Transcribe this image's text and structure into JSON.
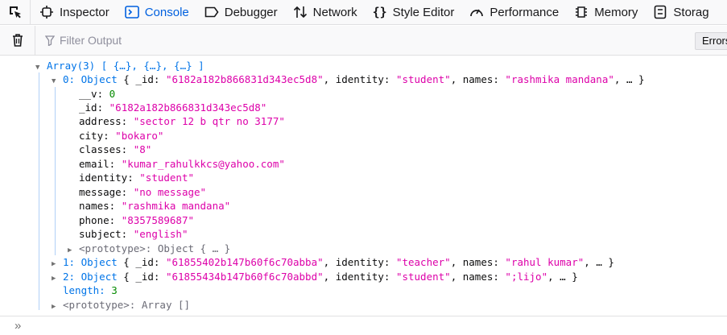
{
  "tabs": [
    {
      "label": "Inspector",
      "icon": "inspector-icon"
    },
    {
      "label": "Console",
      "icon": "console-icon",
      "selected": true
    },
    {
      "label": "Debugger",
      "icon": "debugger-icon"
    },
    {
      "label": "Network",
      "icon": "network-icon"
    },
    {
      "label": "Style Editor",
      "icon": "style-editor-icon"
    },
    {
      "label": "Performance",
      "icon": "performance-icon"
    },
    {
      "label": "Memory",
      "icon": "memory-icon"
    },
    {
      "label": "Storag",
      "icon": "storage-icon"
    }
  ],
  "filter": {
    "placeholder": "Filter Output",
    "errors_label": "Errors"
  },
  "console": {
    "array_header": "Array(3) [ {…}, {…}, {…} ]",
    "item0": {
      "index": "0:",
      "type": "Object",
      "summary_prefix": "{ _id: ",
      "summary_id": "\"6182a182b866831d343ec5d8\"",
      "summary_identity_key": ", identity: ",
      "summary_identity": "\"student\"",
      "summary_names_key": ", names: ",
      "summary_names": "\"rashmika mandana\"",
      "summary_suffix": ", … }",
      "props": [
        {
          "key": "__v:",
          "value": "0",
          "kind": "number"
        },
        {
          "key": "_id:",
          "value": "\"6182a182b866831d343ec5d8\"",
          "kind": "string"
        },
        {
          "key": "address:",
          "value": "\"sector 12 b qtr no 3177\"",
          "kind": "string"
        },
        {
          "key": "city:",
          "value": "\"bokaro\"",
          "kind": "string"
        },
        {
          "key": "classes:",
          "value": "\"8\"",
          "kind": "string"
        },
        {
          "key": "email:",
          "value": "\"kumar_rahulkkcs@yahoo.com\"",
          "kind": "string"
        },
        {
          "key": "identity:",
          "value": "\"student\"",
          "kind": "string"
        },
        {
          "key": "message:",
          "value": "\"no message\"",
          "kind": "string"
        },
        {
          "key": "names:",
          "value": "\"rashmika mandana\"",
          "kind": "string"
        },
        {
          "key": "phone:",
          "value": "\"8357589687\"",
          "kind": "string"
        },
        {
          "key": "subject:",
          "value": "\"english\"",
          "kind": "string"
        }
      ],
      "prototype": "<prototype>:",
      "prototype_value": "Object { … }"
    },
    "item1": {
      "index": "1:",
      "type": "Object",
      "summary_prefix": "{ _id: ",
      "summary_id": "\"61855402b147b60f6c70abba\"",
      "summary_identity_key": ", identity: ",
      "summary_identity": "\"teacher\"",
      "summary_names_key": ", names: ",
      "summary_names": "\"rahul kumar\"",
      "summary_suffix": ", … }"
    },
    "item2": {
      "index": "2:",
      "type": "Object",
      "summary_prefix": "{ _id: ",
      "summary_id": "\"61855434b147b60f6c70abbd\"",
      "summary_identity_key": ", identity: ",
      "summary_identity": "\"student\"",
      "summary_names_key": ", names: ",
      "summary_names": "\";lijo\"",
      "summary_suffix": ", … }"
    },
    "length_key": "length:",
    "length_value": "3",
    "array_prototype": "<prototype>:",
    "array_prototype_value": "Array []"
  },
  "input": {
    "prompt": "»"
  }
}
